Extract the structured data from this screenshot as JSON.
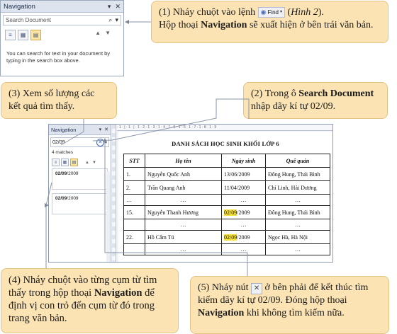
{
  "colors": {
    "callout_bg": "#fbe3b4",
    "callout_border": "#e3c384",
    "highlight": "#f7e23c",
    "pointer_line": "#8a95a8"
  },
  "nav_top": {
    "title": "Navigation",
    "close_glyph": "✕",
    "menu_glyph": "▾",
    "search_placeholder": "Search Document",
    "search_glyph": "⌕",
    "up_glyph": "▲",
    "down_glyph": "▼",
    "hint": "You can search for text in your document by typing in the search box above."
  },
  "nav_side": {
    "title": "Navigation",
    "search_value": "02/09",
    "matches": "4 matches",
    "results": [
      {
        "match": "02/09",
        "rest": "/2009"
      },
      {
        "match": "02/09",
        "rest": "/2009"
      }
    ]
  },
  "ruler_marks": "· 1 · | · 1 · | · 1 · 2 · 1 · 3 · 1 · 4 · 1 · 5 · 1 · 6 · 1 · 7 · 1 · 8 · 1 · 9",
  "document": {
    "title": "DANH SÁCH HỌC SINH KHỐI LỚP 6",
    "headers": [
      "STT",
      "Họ tên",
      "Ngày sinh",
      "Quê quán"
    ],
    "rows": [
      {
        "stt": "1.",
        "name": "Nguyễn Quốc Anh",
        "dob": "13/06/2009",
        "home": "Đông Hung, Thái Bình"
      },
      {
        "stt": "2.",
        "name": "Trần Quang Anh",
        "dob": "11/04/2009",
        "home": "Chí Linh, Hải Dương"
      },
      {
        "stt": "15.",
        "name": "Nguyễn Thanh Hương",
        "dob_hl": "02/09",
        "dob_rest": "/2009",
        "home": "Đông Hung, Thái Bình"
      },
      {
        "stt": "22.",
        "name": "Hồ Cẩm Tú",
        "dob_hl": "02/09",
        "dob_rest": "/2009",
        "home": "Ngọc Hà, Hà Nội"
      }
    ],
    "ellipsis": "…"
  },
  "callouts": {
    "c1": {
      "part1": "(1) Nháy chuột vào lệnh",
      "find_label": "Find",
      "part2": "(",
      "fig": "Hình 2",
      "part3": ").",
      "line2_a": "Hộp thoại ",
      "line2_b": "Navigation",
      "line2_c": " sẽ xuất hiện ở bên trái văn bản."
    },
    "c2": {
      "a": "(2) Trong ô ",
      "b": "Search Document",
      "c": " nhập dãy kí tự 02/09."
    },
    "c3": {
      "text": "(3) Xem số lượng các kết quả tìm thấy."
    },
    "c4": {
      "a": "(4) Nháy chuột vào từng cụm từ tìm thấy trong hộp thoại ",
      "b": "Navigation",
      "c": " để định vị con trỏ đến cụm từ đó trong trang văn bản."
    },
    "c5": {
      "a": "(5) Nháy nút",
      "b": "ở bên phải để kết thúc tìm kiếm dãy kí tự 02/09. Đóng hộp thoại ",
      "c": "Navigation",
      "d": " khi không tìm kiếm nữa."
    }
  }
}
